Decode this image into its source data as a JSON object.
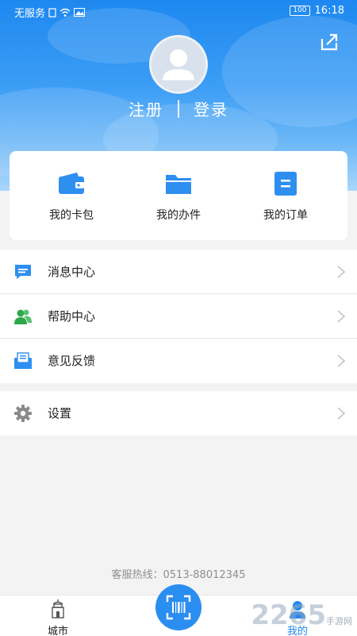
{
  "status_bar": {
    "carrier": "无服务",
    "battery": "100",
    "time": "16:18"
  },
  "header": {
    "register_label": "注册",
    "login_label": "登录"
  },
  "quick_actions": [
    {
      "label": "我的卡包",
      "icon": "wallet-icon"
    },
    {
      "label": "我的办件",
      "icon": "folder-icon"
    },
    {
      "label": "我的订单",
      "icon": "order-icon"
    }
  ],
  "menu": [
    {
      "label": "消息中心",
      "icon": "message-icon"
    },
    {
      "label": "帮助中心",
      "icon": "help-people-icon"
    },
    {
      "label": "意见反馈",
      "icon": "feedback-mail-icon"
    }
  ],
  "settings": {
    "label": "设置",
    "icon": "gear-icon"
  },
  "hotline": "客服热线：0513-88012345",
  "tabbar": {
    "city_label": "城市",
    "mine_label": "我的",
    "active_color": "#1e88f0"
  },
  "watermark": {
    "text": "2265",
    "sub": "手游网"
  },
  "colors": {
    "header_blue": "#1e88f0",
    "accent": "#2a8ef0"
  }
}
